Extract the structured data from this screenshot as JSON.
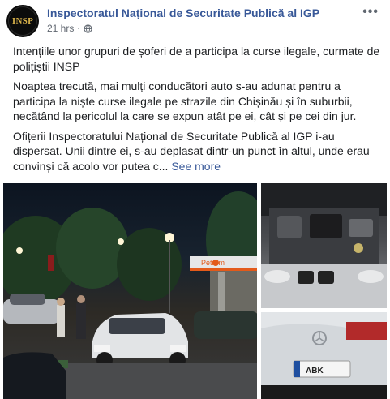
{
  "post": {
    "page_name": "Inspectoratul Național de Securitate Publică al IGP",
    "time": "21 hrs",
    "dot": "·",
    "avatar_text": "INSP",
    "more_icon": "•••",
    "paragraphs": [
      "Intențiile unor grupuri de șoferi de a participa la curse ilegale, curmate de polițiștii INSP",
      "Noaptea trecută, mai mulți conducători auto s-au adunat pentru a participa la niște curse ilegale pe strazile din Chișinău și în suburbii, necătând la pericolul la care se expun atât pe ei, cât și pe cei din jur."
    ],
    "last_paragraph": "Ofițerii Inspectoratului Național de Securitate Publică al IGP i-au dispersat. Unii dintre ei, s-au deplasat dintr-un punct în altul, unde erau convinși că acolo vor putea c...",
    "see_more": "See more",
    "station_sign": "Petrom",
    "plate_text": "ABK"
  },
  "icons": {
    "privacy": "globe-icon",
    "menu": "more-icon"
  },
  "colors": {
    "link": "#385898",
    "text": "#1c1e21",
    "meta": "#606770"
  }
}
